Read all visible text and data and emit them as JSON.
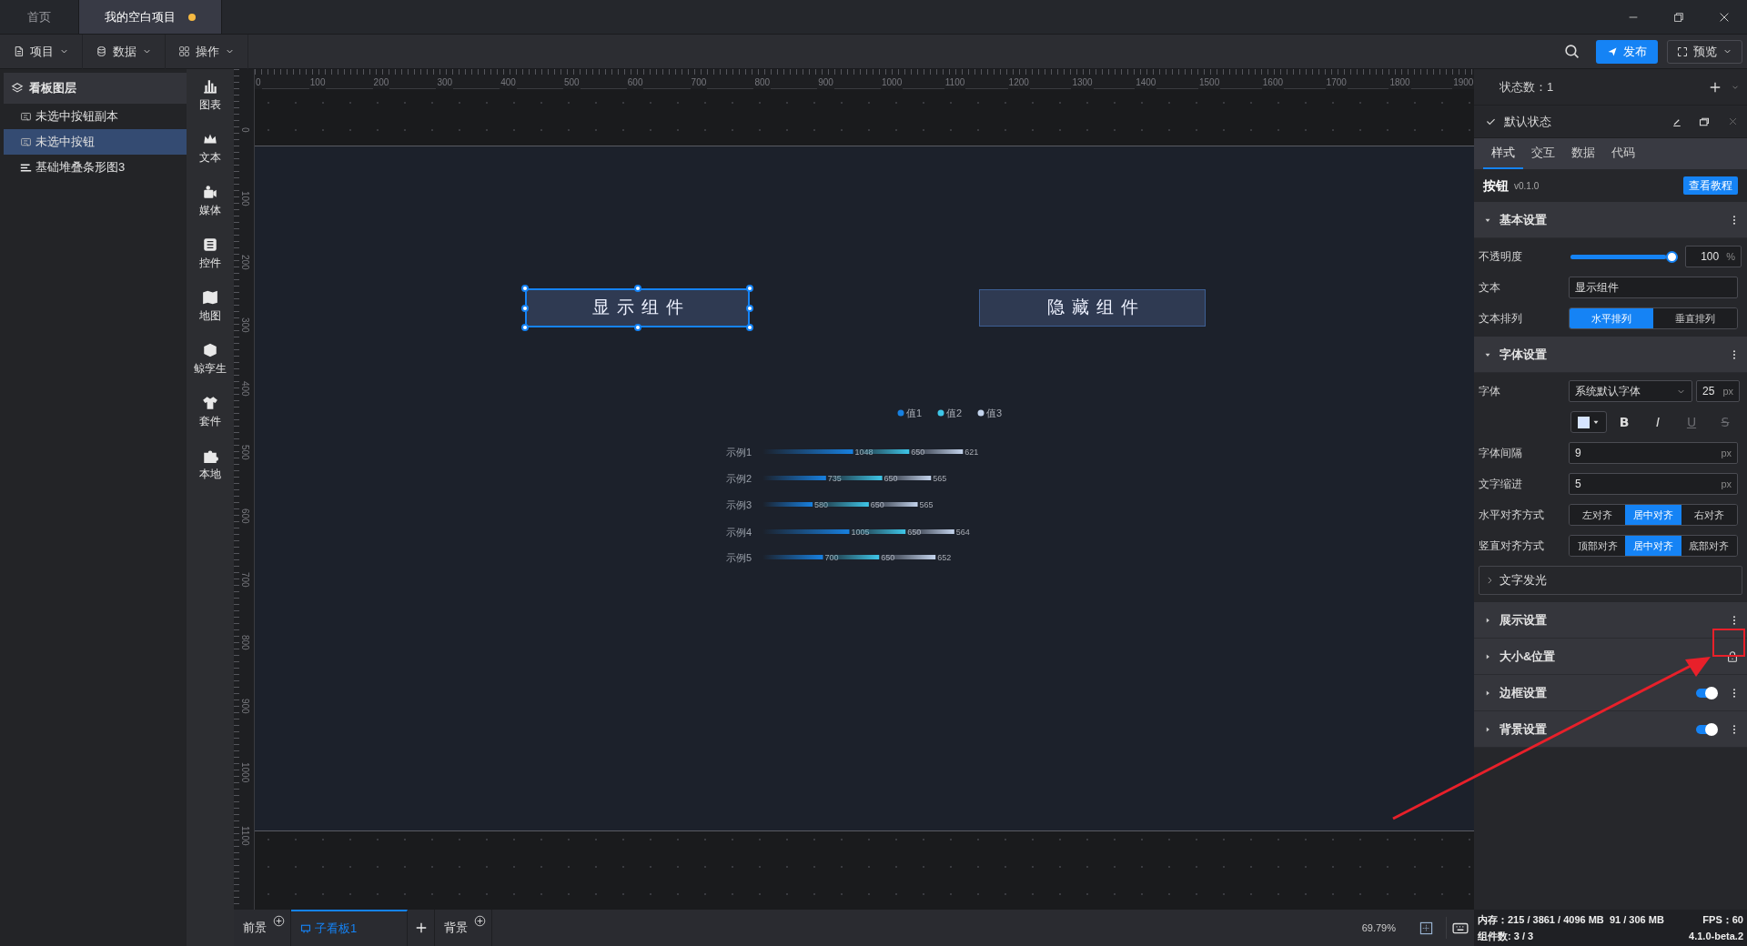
{
  "tabs": [
    {
      "label": "首页",
      "selected": false,
      "modified": false
    },
    {
      "label": "我的空白项目",
      "selected": true,
      "modified": true
    }
  ],
  "menus": [
    "项目",
    "数据",
    "操作"
  ],
  "toolbar": {
    "publish": "发布",
    "preview": "预览"
  },
  "layers": {
    "title": "看板图层",
    "items": [
      {
        "label": "未选中按钮副本",
        "kind": "button",
        "selected": false
      },
      {
        "label": "未选中按钮",
        "kind": "button",
        "selected": true
      },
      {
        "label": "基础堆叠条形图3",
        "kind": "bar-chart",
        "selected": false
      }
    ]
  },
  "components": [
    "图表",
    "文本",
    "媒体",
    "控件",
    "地图",
    "鲸孪生",
    "套件",
    "本地"
  ],
  "ruler": {
    "x_labels": [
      "0",
      "100",
      "200",
      "300",
      "400",
      "500",
      "600",
      "700",
      "800",
      "900",
      "1000",
      "1100",
      "1200",
      "1300",
      "1400",
      "1500",
      "1600",
      "1700",
      "1800",
      "1900"
    ],
    "y_labels": [
      "0",
      "100",
      "200",
      "300",
      "400",
      "500",
      "600",
      "700",
      "800",
      "900",
      "1000",
      "1100"
    ]
  },
  "canvas": {
    "buttons": [
      {
        "label": "显示组件",
        "selected": true
      },
      {
        "label": "隐藏组件",
        "selected": false
      }
    ],
    "chart_data": {
      "type": "bar",
      "orientation": "horizontal",
      "stacked": true,
      "data_labels": true,
      "legend": "top-right",
      "categories": [
        "示例1",
        "示例2",
        "示例3",
        "示例4",
        "示例5"
      ],
      "series": [
        {
          "name": "值1",
          "color": "#1780e0",
          "values": [
            1048,
            735,
            580,
            1005,
            700
          ]
        },
        {
          "name": "值2",
          "color": "#3ec6e8",
          "values": [
            650,
            650,
            650,
            650,
            650
          ]
        },
        {
          "name": "值3",
          "color": "#c3d3ec",
          "values": [
            621,
            565,
            565,
            564,
            652
          ]
        }
      ]
    }
  },
  "panel": {
    "state_count": "状态数：1",
    "state": {
      "label": "默认状态",
      "checked": true
    },
    "tabs": [
      {
        "label": "样式",
        "selected": true
      },
      {
        "label": "交互",
        "selected": false
      },
      {
        "label": "数据",
        "selected": false
      },
      {
        "label": "代码",
        "selected": false
      }
    ],
    "component": {
      "name": "按钮",
      "version": "v0.1.0",
      "help": "查看教程"
    },
    "sections": [
      {
        "title": "基本设置",
        "expanded": true,
        "menu": true,
        "rows": [
          {
            "kind": "slider",
            "label": "不透明度",
            "level": 1,
            "value": "100",
            "unit": "%"
          },
          {
            "kind": "text",
            "label": "文本",
            "value": "显示组件"
          },
          {
            "kind": "segmented",
            "label": "文本排列",
            "options": [
              {
                "label": "水平排列",
                "selected": true
              },
              {
                "label": "垂直排列",
                "selected": false
              }
            ]
          }
        ]
      },
      {
        "title": "字体设置",
        "expanded": true,
        "menu": true,
        "rows": [
          {
            "kind": "font",
            "label": "字体",
            "value": "系统默认字体",
            "size": "25",
            "unit": "px"
          },
          {
            "kind": "style",
            "color": "#d6e4ff",
            "styles": [
              {
                "label": "B",
                "kind": "bold",
                "disabled": false
              },
              {
                "label": "I",
                "kind": "italic",
                "disabled": false
              },
              {
                "label": "U",
                "kind": "underline",
                "disabled": true
              },
              {
                "label": "S",
                "kind": "strike",
                "disabled": true
              }
            ]
          },
          {
            "kind": "number",
            "label": "字体间隔",
            "value": "9",
            "unit": "px"
          },
          {
            "kind": "number",
            "label": "文字缩进",
            "value": "5",
            "unit": "px"
          },
          {
            "kind": "segmented",
            "label": "水平对齐方式",
            "options": [
              {
                "label": "左对齐",
                "selected": false
              },
              {
                "label": "居中对齐",
                "selected": true
              },
              {
                "label": "右对齐",
                "selected": false
              }
            ]
          },
          {
            "kind": "segmented",
            "label": "竖直对齐方式",
            "options": [
              {
                "label": "顶部对齐",
                "selected": false
              },
              {
                "label": "居中对齐",
                "selected": true
              },
              {
                "label": "底部对齐",
                "selected": false
              }
            ]
          },
          {
            "kind": "collapsible",
            "label": "文字发光",
            "expanded": false
          }
        ]
      },
      {
        "title": "展示设置",
        "expanded": false,
        "menu": true
      },
      {
        "title": "大小&位置",
        "expanded": false,
        "menu": false,
        "lock": true
      },
      {
        "title": "边框设置",
        "expanded": false,
        "menu": true,
        "toggle": {
          "on": true
        }
      },
      {
        "title": "背景设置",
        "expanded": false,
        "menu": true,
        "toggle": {
          "on": true
        }
      }
    ]
  },
  "bottom_tabs": [
    {
      "label": "前景",
      "kind": "layer",
      "selected": false
    },
    {
      "label": "子看板1",
      "kind": "board",
      "selected": true
    },
    {
      "label": "背景",
      "kind": "layer",
      "selected": false
    }
  ],
  "zoom": "69.79%",
  "status": {
    "memory": "内存：215 / 3861 / 4096 MB  91 / 306 MB",
    "fps": "FPS：60",
    "count": "组件数: 3 / 3",
    "version": "4.1.0-beta.2"
  }
}
